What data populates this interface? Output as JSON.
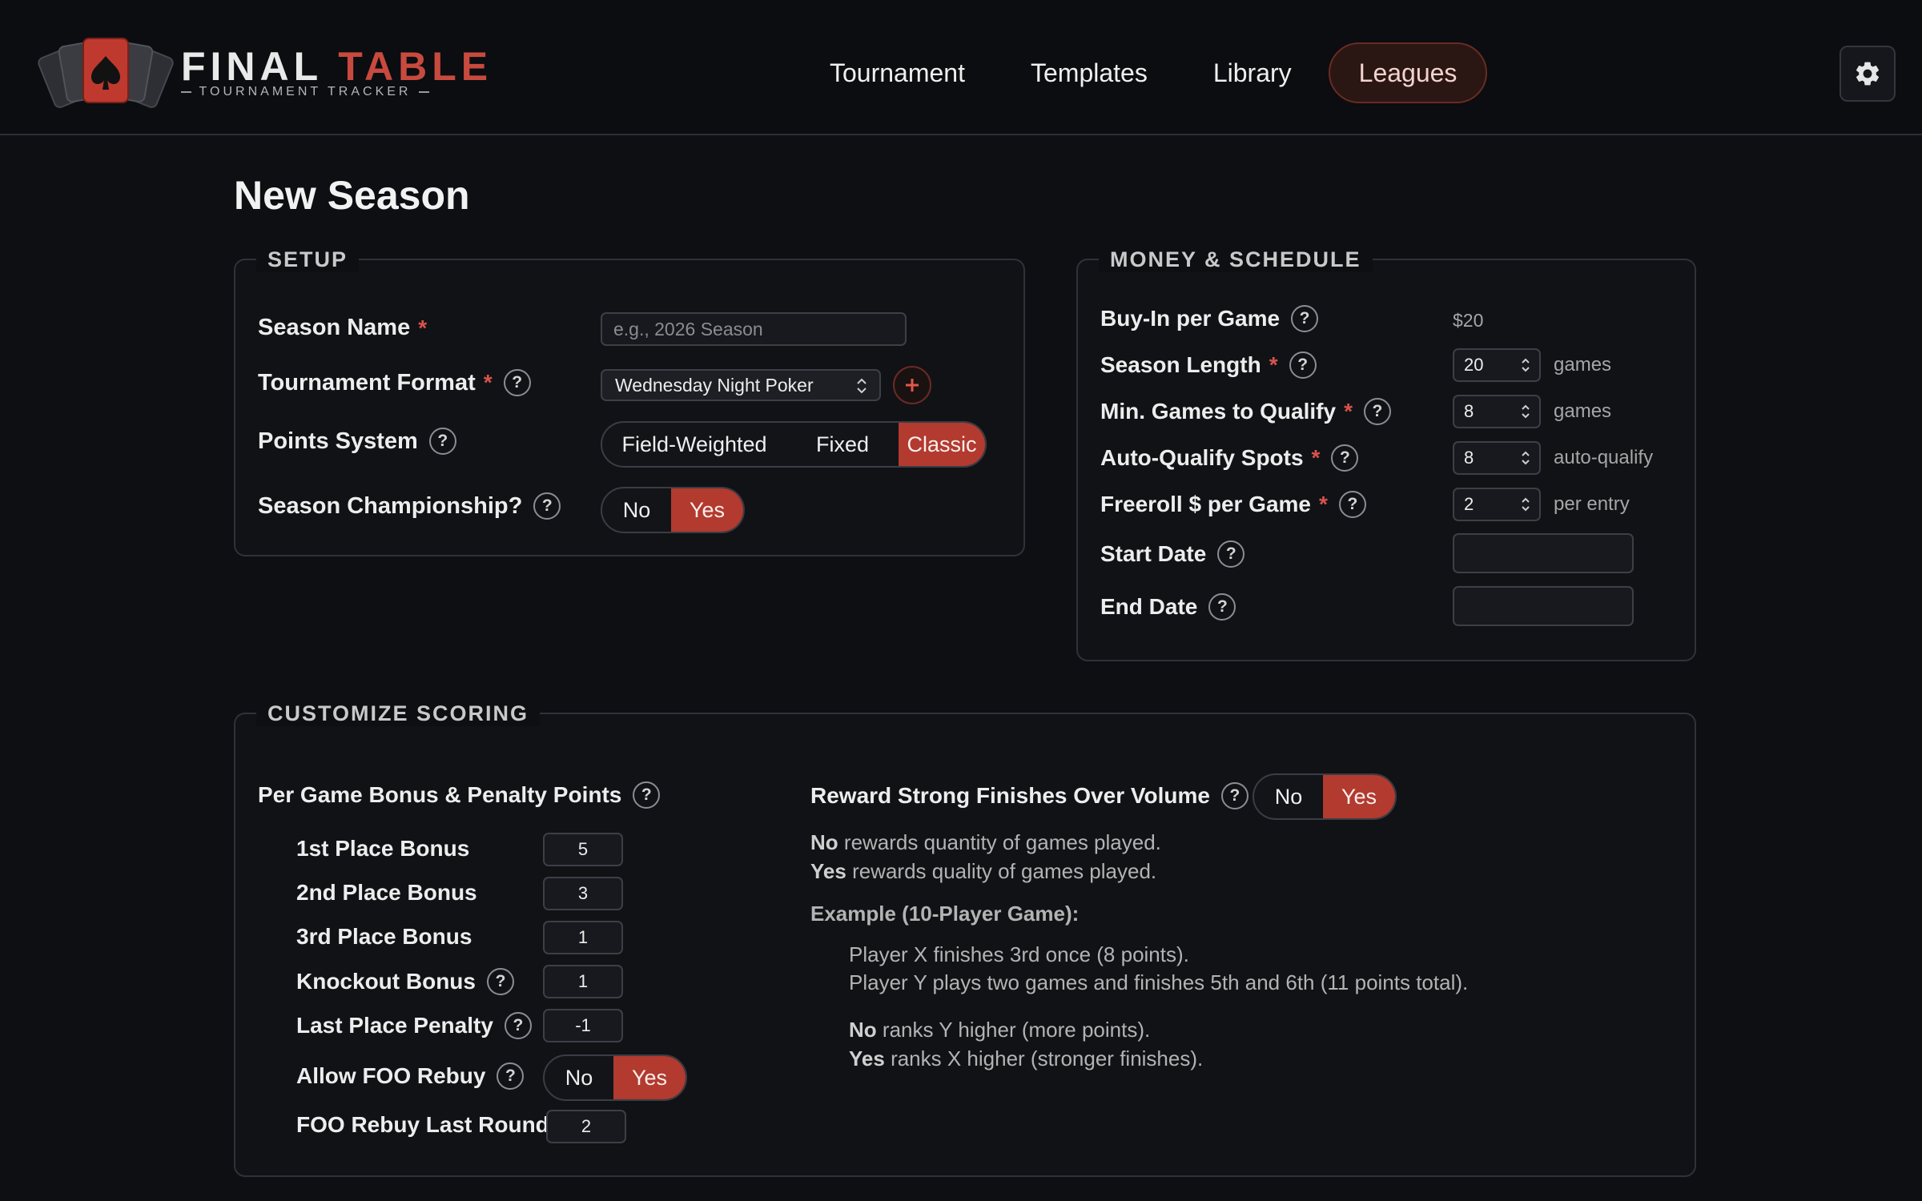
{
  "header": {
    "logo_word1": "FINAL",
    "logo_word2": "TABLE",
    "logo_sub": "TOURNAMENT TRACKER",
    "nav": [
      "Tournament",
      "Templates",
      "Library",
      "Leagues"
    ],
    "active_nav": "Leagues"
  },
  "page": {
    "title": "New Season"
  },
  "setup": {
    "legend": "SETUP",
    "season_name": {
      "label": "Season Name",
      "placeholder": "e.g., 2026 Season",
      "value": ""
    },
    "format": {
      "label": "Tournament Format",
      "value": "Wednesday Night Poker"
    },
    "points": {
      "label": "Points System",
      "options": [
        "Field-Weighted",
        "Fixed",
        "Classic"
      ],
      "selected": "Classic"
    },
    "championship": {
      "label": "Season Championship?",
      "options": [
        "No",
        "Yes"
      ],
      "selected": "Yes"
    }
  },
  "money": {
    "legend": "MONEY & SCHEDULE",
    "buyin": {
      "label": "Buy-In per Game",
      "value": "$20"
    },
    "season_length": {
      "label": "Season Length",
      "value": "20",
      "unit": "games"
    },
    "min_games": {
      "label": "Min. Games to Qualify",
      "value": "8",
      "unit": "games"
    },
    "auto_qualify": {
      "label": "Auto-Qualify Spots",
      "value": "8",
      "unit": "auto-qualify"
    },
    "freeroll": {
      "label": "Freeroll $ per Game",
      "value": "2",
      "unit": "per entry"
    },
    "start_date": {
      "label": "Start Date",
      "value": ""
    },
    "end_date": {
      "label": "End Date",
      "value": ""
    }
  },
  "scoring": {
    "legend": "CUSTOMIZE SCORING",
    "bonus_heading": "Per Game Bonus & Penalty Points",
    "first": {
      "label": "1st Place Bonus",
      "value": "5"
    },
    "second": {
      "label": "2nd Place Bonus",
      "value": "3"
    },
    "third": {
      "label": "3rd Place Bonus",
      "value": "1"
    },
    "knockout": {
      "label": "Knockout Bonus",
      "value": "1"
    },
    "last_penalty": {
      "label": "Last Place Penalty",
      "value": "-1"
    },
    "foo_rebuy": {
      "label": "Allow FOO Rebuy",
      "options": [
        "No",
        "Yes"
      ],
      "selected": "Yes"
    },
    "foo_last_round": {
      "label": "FOO Rebuy Last Round",
      "value": "2"
    },
    "reward": {
      "label": "Reward Strong Finishes Over Volume",
      "options": [
        "No",
        "Yes"
      ],
      "selected": "Yes",
      "no_kw": "No",
      "no_text": "rewards quantity of games played.",
      "yes_kw": "Yes",
      "yes_text": "rewards quality of games played.",
      "example_heading": "Example (10-Player Game):",
      "example_x": "Player X finishes 3rd once (8 points).",
      "example_y": "Player Y plays two games and finishes 5th and 6th (11 points total).",
      "result_no_kw": "No",
      "result_no_text": "ranks Y higher (more points).",
      "result_yes_kw": "Yes",
      "result_yes_text": "ranks X higher (stronger finishes)."
    }
  },
  "colors": {
    "accent": "#b23a2f",
    "background": "#0d0f13",
    "panel_border": "#2f323a"
  }
}
